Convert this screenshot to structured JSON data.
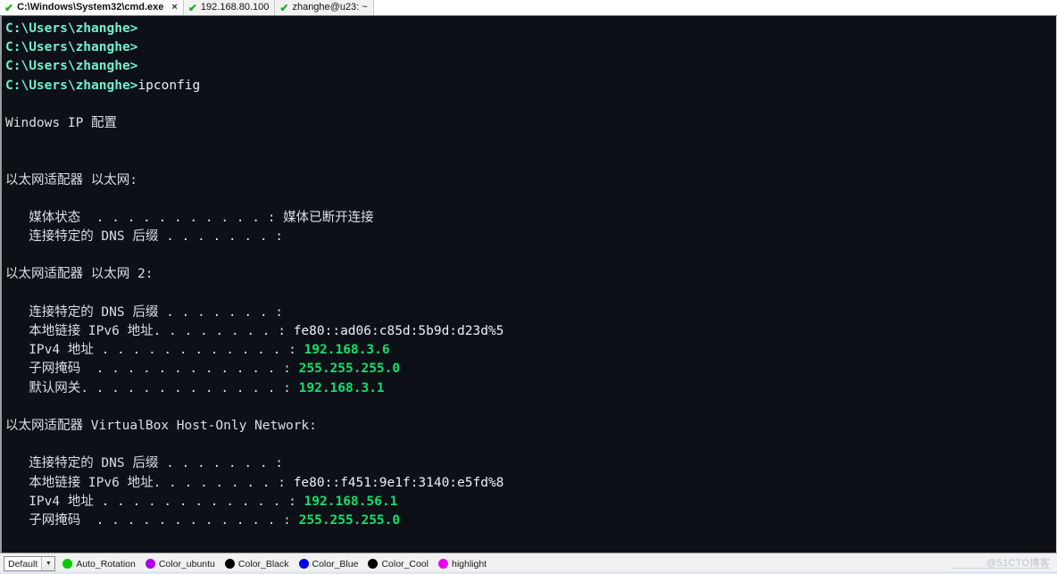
{
  "window": {
    "title": "C:\\Windows\\System32\\cmd.exe"
  },
  "tabbar": {
    "tabs": [
      {
        "label": "C:\\Windows\\System32\\cmd.exe",
        "status_icon": "check-icon",
        "active": true,
        "close_label": "×"
      },
      {
        "label": "192.168.80.100",
        "status_icon": "check-icon",
        "active": false
      },
      {
        "label": "zhanghe@u23: ~",
        "status_icon": "check-icon",
        "active": false
      }
    ]
  },
  "terminal": {
    "prompt": "C:\\Users\\zhanghe>",
    "command": "ipconfig",
    "lines": [
      {
        "type": "prompt",
        "prompt": "C:\\Users\\zhanghe>",
        "text": ""
      },
      {
        "type": "prompt",
        "prompt": "C:\\Users\\zhanghe>",
        "text": ""
      },
      {
        "type": "prompt",
        "prompt": "C:\\Users\\zhanghe>",
        "text": ""
      },
      {
        "type": "prompt",
        "prompt": "C:\\Users\\zhanghe>",
        "text": "ipconfig"
      },
      {
        "type": "blank",
        "text": ""
      },
      {
        "type": "plain",
        "text": "Windows IP 配置"
      },
      {
        "type": "blank",
        "text": ""
      },
      {
        "type": "blank",
        "text": ""
      },
      {
        "type": "plain",
        "text": "以太网适配器 以太网:"
      },
      {
        "type": "blank",
        "text": ""
      },
      {
        "type": "plain",
        "text": "   媒体状态  . . . . . . . . . . . : 媒体已断开连接"
      },
      {
        "type": "plain",
        "text": "   连接特定的 DNS 后缀 . . . . . . . :"
      },
      {
        "type": "blank",
        "text": ""
      },
      {
        "type": "plain",
        "text": "以太网适配器 以太网 2:"
      },
      {
        "type": "blank",
        "text": ""
      },
      {
        "type": "plain",
        "text": "   连接特定的 DNS 后缀 . . . . . . . :"
      },
      {
        "type": "value",
        "label": "   本地链接 IPv6 地址. . . . . . . . : ",
        "value": "fe80::ad06:c85d:5b9d:d23d%5",
        "highlight": false
      },
      {
        "type": "value",
        "label": "   IPv4 地址 . . . . . . . . . . . . : ",
        "value": "192.168.3.6",
        "highlight": true
      },
      {
        "type": "value",
        "label": "   子网掩码  . . . . . . . . . . . . : ",
        "value": "255.255.255.0",
        "highlight": true
      },
      {
        "type": "value",
        "label": "   默认网关. . . . . . . . . . . . . : ",
        "value": "192.168.3.1",
        "highlight": true
      },
      {
        "type": "blank",
        "text": ""
      },
      {
        "type": "plain",
        "text": "以太网适配器 VirtualBox Host-Only Network:"
      },
      {
        "type": "blank",
        "text": ""
      },
      {
        "type": "plain",
        "text": "   连接特定的 DNS 后缀 . . . . . . . :"
      },
      {
        "type": "value",
        "label": "   本地链接 IPv6 地址. . . . . . . . : ",
        "value": "fe80::f451:9e1f:3140:e5fd%8",
        "highlight": false
      },
      {
        "type": "value",
        "label": "   IPv4 地址 . . . . . . . . . . . . : ",
        "value": "192.168.56.1",
        "highlight": true
      },
      {
        "type": "value",
        "label": "   子网掩码  . . . . . . . . . . . . : ",
        "value": "255.255.255.0",
        "highlight": true
      }
    ]
  },
  "bottombar": {
    "scheme_select": {
      "value": "Default",
      "arrow": "▼"
    },
    "color_items": [
      {
        "label": "Auto_Rotation",
        "color": "#00cc00"
      },
      {
        "label": "Color_ubuntu",
        "color": "#aa00ee"
      },
      {
        "label": "Color_Black",
        "color": "#000000"
      },
      {
        "label": "Color_Blue",
        "color": "#0000ee"
      },
      {
        "label": "Color_Cool",
        "color": "#000000"
      },
      {
        "label": "highlight",
        "color": "#ee00ee"
      }
    ],
    "watermark": "@51CTO博客"
  },
  "colors": {
    "terminal_bg": "#0d1017",
    "prompt_fg": "#6ff2cd",
    "text_fg": "#e8e8ec",
    "highlight_fg": "#12e06a",
    "tab_check": "#19b319"
  }
}
